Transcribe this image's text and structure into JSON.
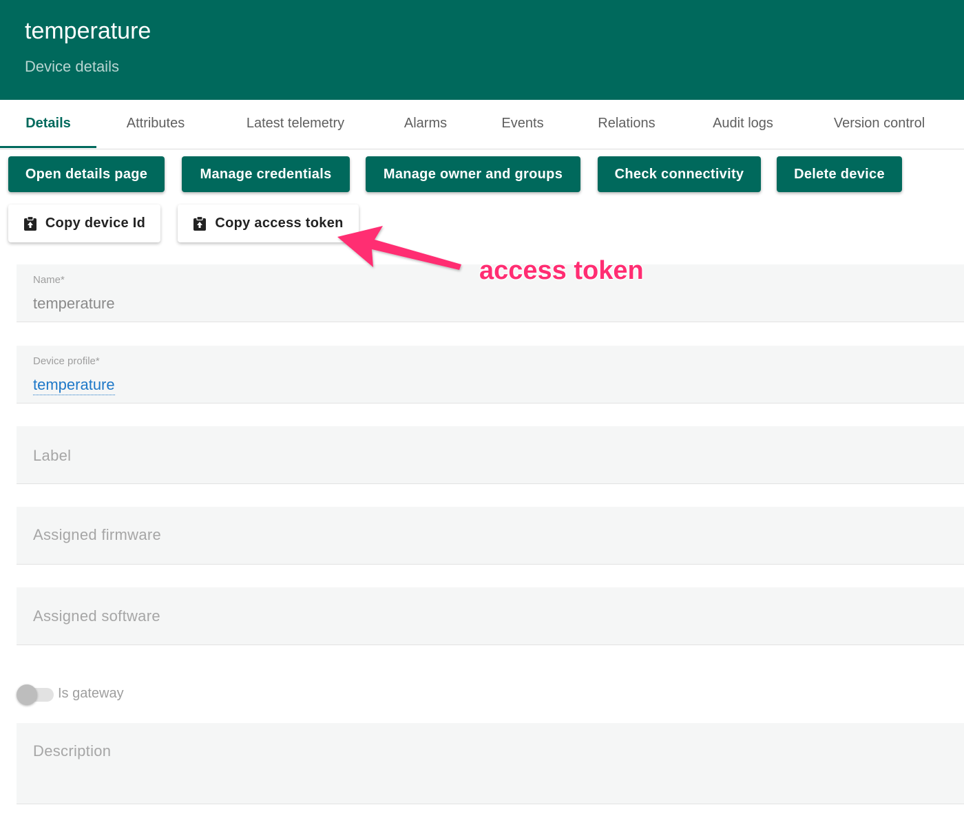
{
  "header": {
    "title": "temperature",
    "subtitle": "Device details"
  },
  "tabs": [
    {
      "label": "Details",
      "active": true
    },
    {
      "label": "Attributes"
    },
    {
      "label": "Latest telemetry"
    },
    {
      "label": "Alarms"
    },
    {
      "label": "Events"
    },
    {
      "label": "Relations"
    },
    {
      "label": "Audit logs"
    },
    {
      "label": "Version control"
    }
  ],
  "actions": {
    "open_details": "Open details page",
    "manage_credentials": "Manage credentials",
    "manage_owner": "Manage owner and groups",
    "check_connectivity": "Check connectivity",
    "delete_device": "Delete device",
    "copy_device_id": "Copy device Id",
    "copy_access_token": "Copy access token"
  },
  "form": {
    "name": {
      "label": "Name*",
      "value": "temperature"
    },
    "device_profile": {
      "label": "Device profile*",
      "value": "temperature"
    },
    "label": {
      "placeholder": "Label"
    },
    "firmware": {
      "placeholder": "Assigned firmware"
    },
    "software": {
      "placeholder": "Assigned software"
    },
    "is_gateway": {
      "label": "Is gateway",
      "checked": false
    },
    "description": {
      "placeholder": "Description"
    }
  },
  "annotation": {
    "text": "access token",
    "color": "#ff2d72"
  },
  "colors": {
    "primary": "#00695c",
    "link": "#1e78c8"
  },
  "icons": {
    "copy": "clipboard-icon",
    "arrow": "arrow-icon"
  }
}
